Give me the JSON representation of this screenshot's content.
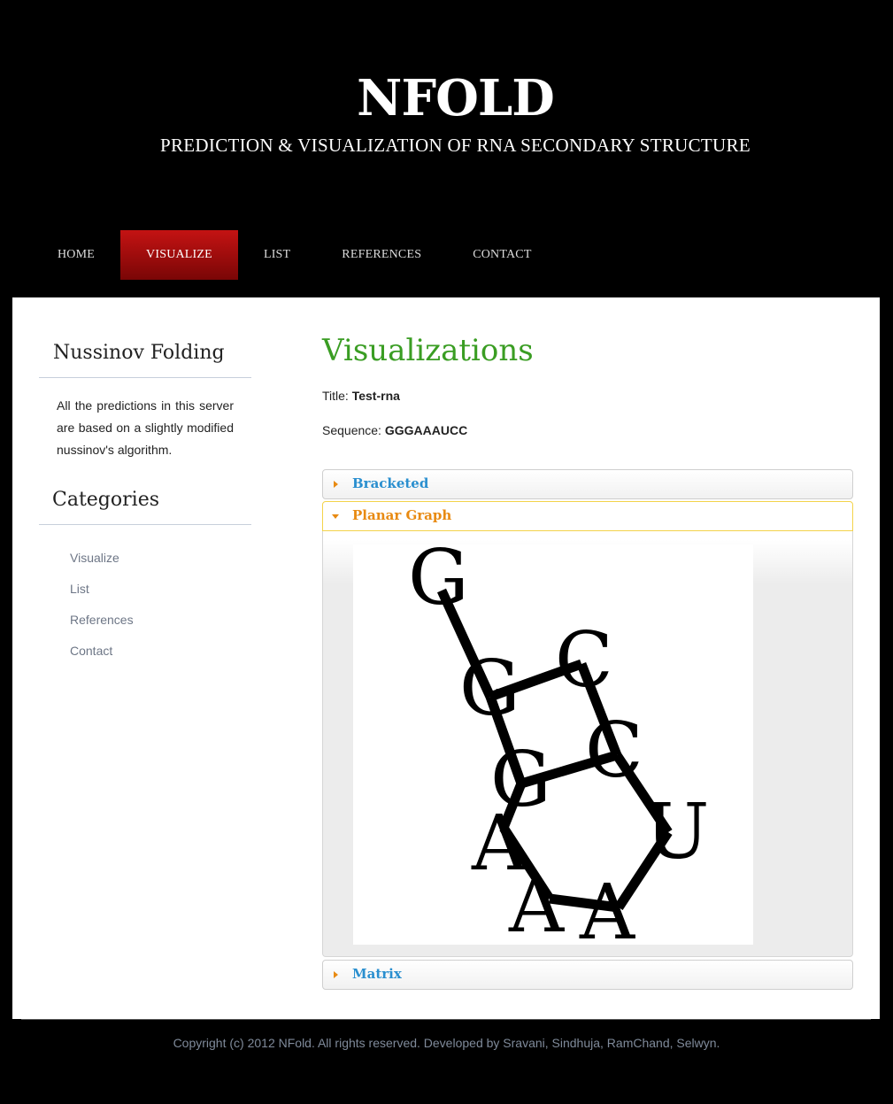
{
  "header": {
    "title": "NFOLD",
    "subtitle": "PREDICTION & VISUALIZATION OF RNA SECONDARY STRUCTURE"
  },
  "nav": {
    "items": [
      {
        "label": "HOME",
        "active": false
      },
      {
        "label": "VISUALIZE",
        "active": true
      },
      {
        "label": "LIST",
        "active": false
      },
      {
        "label": "REFERENCES",
        "active": false
      },
      {
        "label": "CONTACT",
        "active": false
      }
    ]
  },
  "sidebar": {
    "about_title": "Nussinov Folding",
    "about_text": "All the predictions in this server are based on a slightly modified nussinov's algorithm.",
    "categories_title": "Categories",
    "categories": [
      "Visualize",
      "List",
      "References",
      "Contact"
    ]
  },
  "main": {
    "title": "Visualizations",
    "title_label": "Title:",
    "title_value": "Test-rna",
    "sequence_label": "Sequence:",
    "sequence_value": "GGGAAAUCC",
    "accordion": [
      {
        "label": "Bracketed",
        "open": false
      },
      {
        "label": "Planar Graph",
        "open": true
      },
      {
        "label": "Matrix",
        "open": false
      }
    ],
    "graph_nucleotides": [
      "G",
      "G",
      "G",
      "A",
      "A",
      "A",
      "U",
      "C",
      "C"
    ]
  },
  "footer": {
    "text": "Copyright (c) 2012 NFold. All rights reserved. Developed by Sravani, Sindhuja, RamChand, Selwyn."
  },
  "colors": {
    "accent_green": "#3a9d23",
    "nav_active": "#b00e0e",
    "accordion_link": "#2a8fcf",
    "accordion_open": "#e88a12"
  }
}
